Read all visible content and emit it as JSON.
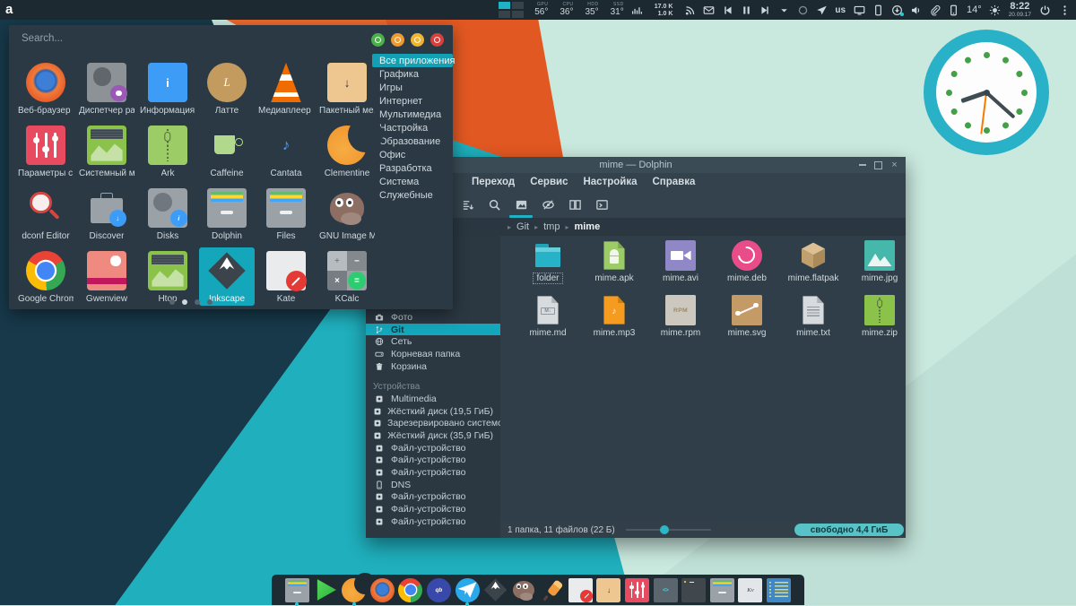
{
  "panel": {
    "launcher_logo": "a",
    "pager": {
      "desktops": 4,
      "active_index": 0
    },
    "monitors": [
      {
        "label": "GPU",
        "value": "56°"
      },
      {
        "label": "CPU",
        "value": "36°"
      },
      {
        "label": "HDD",
        "value": "35°"
      },
      {
        "label": "SSD",
        "value": "31°"
      }
    ],
    "network": {
      "up": "17.0 K",
      "down": "1.0 K"
    },
    "tray_left_icons": [
      "rss-icon",
      "mail-icon",
      "media-previous-icon",
      "media-pause-icon",
      "media-next-icon",
      "chevron-down-icon",
      "session-circle-icon",
      "network-send-icon"
    ],
    "keyboard_layout": "us",
    "tray_right_icons": [
      "monitor-icon",
      "phone-icon",
      "updates-icon",
      "volume-icon",
      "paperclip-icon",
      "smartphone-icon"
    ],
    "temperature": "14°",
    "clock_time": "8:22",
    "clock_date": "20.09.17"
  },
  "launcher": {
    "search_placeholder": "Search...",
    "session_buttons": [
      {
        "name": "logout-button",
        "color": "#49b04a"
      },
      {
        "name": "lock-button",
        "color": "#ef9a2e"
      },
      {
        "name": "restart-button",
        "color": "#f0b42f"
      },
      {
        "name": "shutdown-button",
        "color": "#d8403c"
      }
    ],
    "categories": [
      {
        "label": "Все приложения",
        "active": true
      },
      {
        "label": "Графика"
      },
      {
        "label": "Игры"
      },
      {
        "label": "Интернет"
      },
      {
        "label": "Мультимедиа"
      },
      {
        "label": "Настройка"
      },
      {
        "label": "Образование"
      },
      {
        "label": "Офис"
      },
      {
        "label": "Разработка"
      },
      {
        "label": "Система"
      },
      {
        "label": "Служебные"
      }
    ],
    "apps": [
      {
        "label": "Веб-браузер …",
        "icon": "firefox"
      },
      {
        "label": "Диспетчер ра…",
        "icon": "taskmgr"
      },
      {
        "label": "Информация …",
        "icon": "info"
      },
      {
        "label": "Латте",
        "icon": "latte"
      },
      {
        "label": "Медиаплеер …",
        "icon": "vlc"
      },
      {
        "label": "Пакетный ме…",
        "icon": "pkgdown"
      },
      {
        "label": "Параметры с…",
        "icon": "params"
      },
      {
        "label": "Системный м…",
        "icon": "chart"
      },
      {
        "label": "Ark",
        "icon": "ark"
      },
      {
        "label": "Caffeine",
        "icon": "caffeine"
      },
      {
        "label": "Cantata",
        "icon": "cantata"
      },
      {
        "label": "Clementine",
        "icon": "clementine"
      },
      {
        "label": "dconf Editor",
        "icon": "dconf"
      },
      {
        "label": "Discover",
        "icon": "discover"
      },
      {
        "label": "Disks",
        "icon": "disks"
      },
      {
        "label": "Dolphin",
        "icon": "cabinet"
      },
      {
        "label": "Files",
        "icon": "cabinet"
      },
      {
        "label": "GNU Image M…",
        "icon": "gimp"
      },
      {
        "label": "Google Chrome",
        "icon": "chrome"
      },
      {
        "label": "Gwenview",
        "icon": "gwenview"
      },
      {
        "label": "Htop",
        "icon": "chart"
      },
      {
        "label": "Inkscape",
        "icon": "inkscape",
        "selected": true
      },
      {
        "label": "Kate",
        "icon": "kate"
      },
      {
        "label": "KCalc",
        "icon": "kcalc"
      }
    ],
    "page_dots": {
      "count": 4,
      "active_index": 1
    }
  },
  "dolphin": {
    "title": "mime — Dolphin",
    "menu_items": [
      "Переход",
      "Сервис",
      "Настройка",
      "Справка"
    ],
    "toolbar_icons": [
      {
        "icon": "sort-icon"
      },
      {
        "icon": "search-icon"
      },
      {
        "icon": "preview-icon",
        "active": true
      },
      {
        "icon": "hidden-files-icon"
      },
      {
        "icon": "split-view-icon"
      },
      {
        "icon": "terminal-icon"
      }
    ],
    "breadcrumb": [
      "Git",
      "tmp",
      "mime"
    ],
    "places": {
      "items": [
        {
          "label": "Фото",
          "icon": "camera-icon"
        },
        {
          "label": "Git",
          "icon": "git-icon",
          "selected": true
        },
        {
          "label": "Сеть",
          "icon": "globe-icon"
        },
        {
          "label": "Корневая папка",
          "icon": "drive-icon"
        },
        {
          "label": "Корзина",
          "icon": "trash-icon"
        }
      ],
      "devices_header": "Устройства",
      "devices": [
        {
          "label": "Multimedia",
          "icon": "device-icon"
        },
        {
          "label": "Жёсткий диск (19,5 ГиБ)",
          "icon": "device-icon"
        },
        {
          "label": "Зарезервировано системой",
          "icon": "device-icon"
        },
        {
          "label": "Жёсткий диск (35,9 ГиБ)",
          "icon": "device-icon"
        },
        {
          "label": "Файл-устройство",
          "icon": "device-icon"
        },
        {
          "label": "Файл-устройство",
          "icon": "device-icon"
        },
        {
          "label": "Файл-устройство",
          "icon": "device-icon"
        },
        {
          "label": "DNS",
          "icon": "smartphone-icon"
        },
        {
          "label": "Файл-устройство",
          "icon": "device-icon"
        },
        {
          "label": "Файл-устройство",
          "icon": "device-icon"
        },
        {
          "label": "Файл-устройство",
          "icon": "device-icon"
        }
      ]
    },
    "files": [
      {
        "label": "folder",
        "icon": "folder",
        "focused": true
      },
      {
        "label": "mime.apk",
        "icon": "apk"
      },
      {
        "label": "mime.avi",
        "icon": "avi"
      },
      {
        "label": "mime.deb",
        "icon": "deb"
      },
      {
        "label": "mime.flatpak",
        "icon": "flatpak"
      },
      {
        "label": "mime.jpg",
        "icon": "jpg"
      },
      {
        "label": "mime.md",
        "icon": "md"
      },
      {
        "label": "mime.mp3",
        "icon": "mp3"
      },
      {
        "label": "mime.rpm",
        "icon": "rpm"
      },
      {
        "label": "mime.svg",
        "icon": "svg"
      },
      {
        "label": "mime.txt",
        "icon": "txt"
      },
      {
        "label": "mime.zip",
        "icon": "zip"
      }
    ],
    "statusbar": {
      "summary": "1 папка, 11 файлов (22 Б)",
      "free_space": "свободно 4,4 ГиБ",
      "zoom_percent": 40
    }
  },
  "clock_widget": {
    "time": "8:22",
    "accent": "#28b1c7"
  },
  "dock": {
    "items": [
      {
        "name": "dolphin",
        "icon": "cabinet",
        "running": true
      },
      {
        "name": "media-player",
        "icon": "play"
      },
      {
        "name": "clementine",
        "icon": "clementine",
        "running": true
      },
      {
        "name": "firefox",
        "icon": "firefox"
      },
      {
        "name": "chrome",
        "icon": "chrome"
      },
      {
        "name": "qbittorrent",
        "icon": "qb"
      },
      {
        "name": "telegram",
        "icon": "telegram",
        "running": true
      },
      {
        "name": "inkscape",
        "icon": "inkscape"
      },
      {
        "name": "gimp",
        "icon": "gimp"
      },
      {
        "name": "color-picker",
        "icon": "picker"
      },
      {
        "name": "kate",
        "icon": "kate"
      },
      {
        "name": "package-manager",
        "icon": "pkgdown"
      },
      {
        "name": "system-settings",
        "icon": "params"
      },
      {
        "name": "code-editor",
        "icon": "code"
      },
      {
        "name": "terminal",
        "icon": "darkterm"
      },
      {
        "name": "file-manager",
        "icon": "cabinet"
      },
      {
        "name": "kvantum",
        "icon": "kv"
      },
      {
        "name": "tasks",
        "icon": "checklist"
      }
    ]
  }
}
